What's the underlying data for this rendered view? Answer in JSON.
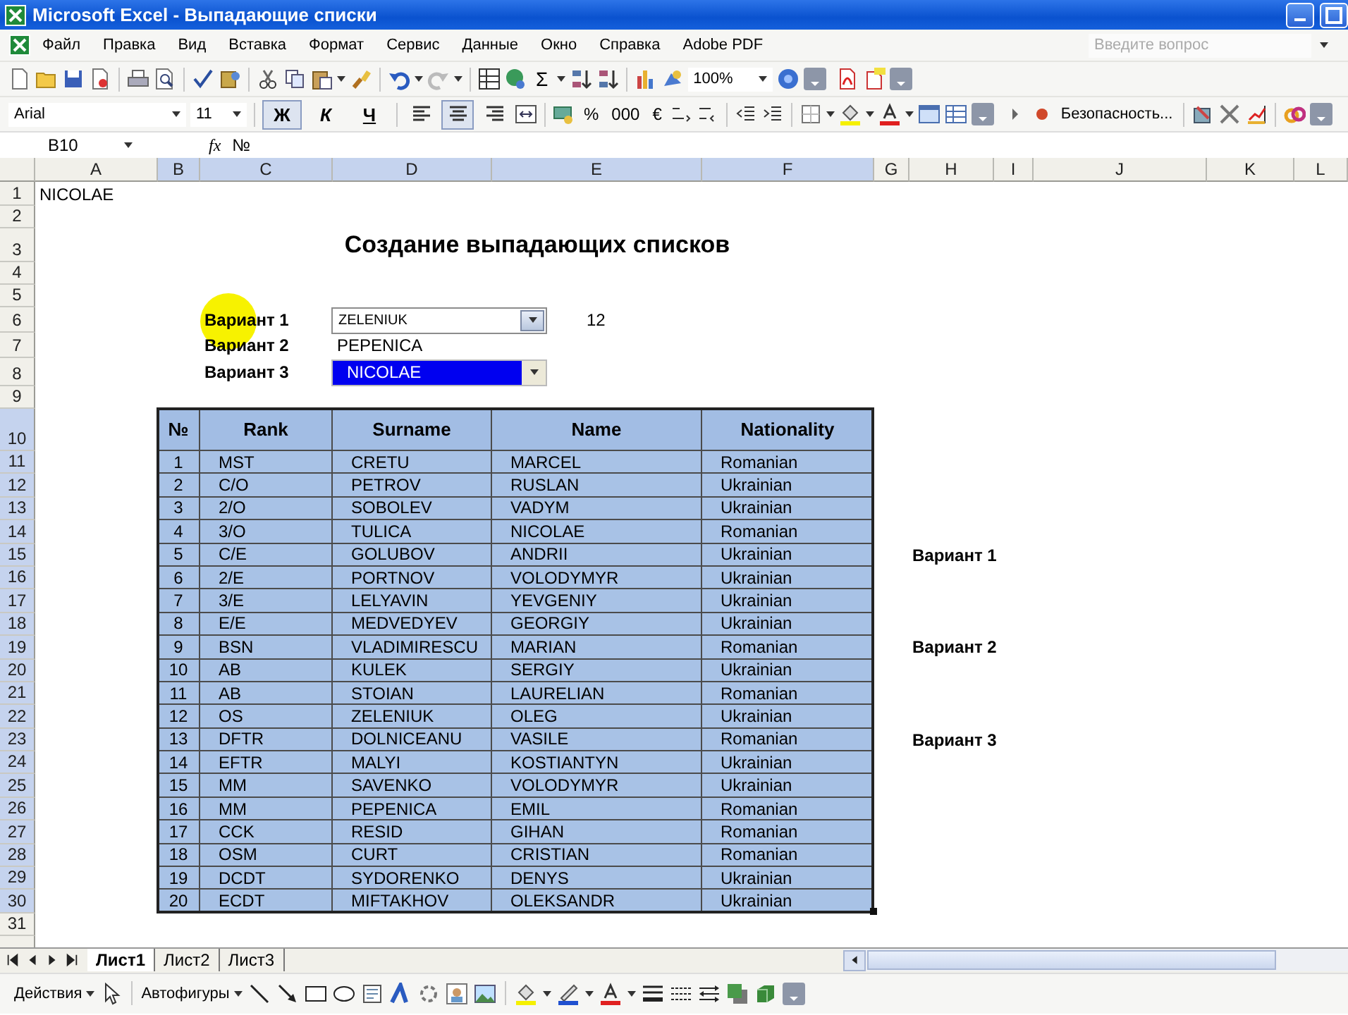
{
  "window": {
    "title": "Microsoft Excel - Выпадающие списки"
  },
  "menu": [
    "Файл",
    "Правка",
    "Вид",
    "Вставка",
    "Формат",
    "Сервис",
    "Данные",
    "Окно",
    "Справка",
    "Adobe PDF"
  ],
  "help_search": {
    "placeholder": "Введите вопрос"
  },
  "toolbar": {
    "sum": "Σ",
    "zoom": "100%",
    "font": "Arial",
    "font_size": "11",
    "security": "Безопасность...",
    "style_buttons": [
      {
        "label": "Ж",
        "pressed": true
      },
      {
        "label": "К",
        "pressed": false
      },
      {
        "label": "Ч",
        "pressed": false
      }
    ],
    "alignment": [
      {
        "selected": false
      },
      {
        "selected": true
      },
      {
        "selected": false
      }
    ],
    "number_formats": [
      "%",
      "000",
      "€"
    ]
  },
  "formula_bar": {
    "cell": "B10",
    "fx": "fx",
    "formula": "№"
  },
  "columns": [
    {
      "label": "A",
      "selected": false
    },
    {
      "label": "B",
      "selected": true
    },
    {
      "label": "C",
      "selected": true
    },
    {
      "label": "D",
      "selected": true
    },
    {
      "label": "E",
      "selected": true
    },
    {
      "label": "F",
      "selected": true
    },
    {
      "label": "G",
      "selected": false
    },
    {
      "label": "H",
      "selected": false
    },
    {
      "label": "I",
      "selected": false
    },
    {
      "label": "J",
      "selected": false
    },
    {
      "label": "K",
      "selected": false
    },
    {
      "label": "L",
      "selected": false
    }
  ],
  "rows": [
    {
      "label": "1",
      "selected": false
    },
    {
      "label": "2",
      "selected": false
    },
    {
      "label": "3",
      "selected": false
    },
    {
      "label": "4",
      "selected": false
    },
    {
      "label": "5",
      "selected": false
    },
    {
      "label": "6",
      "selected": false
    },
    {
      "label": "7",
      "selected": false
    },
    {
      "label": "8",
      "selected": false
    },
    {
      "label": "9",
      "selected": false
    },
    {
      "label": "10",
      "selected": true
    },
    {
      "label": "11",
      "selected": true
    },
    {
      "label": "12",
      "selected": true
    },
    {
      "label": "13",
      "selected": true
    },
    {
      "label": "14",
      "selected": true
    },
    {
      "label": "15",
      "selected": true
    },
    {
      "label": "16",
      "selected": true
    },
    {
      "label": "17",
      "selected": true
    },
    {
      "label": "18",
      "selected": true
    },
    {
      "label": "19",
      "selected": true
    },
    {
      "label": "20",
      "selected": true
    },
    {
      "label": "21",
      "selected": true
    },
    {
      "label": "22",
      "selected": true
    },
    {
      "label": "23",
      "selected": true
    },
    {
      "label": "24",
      "selected": true
    },
    {
      "label": "25",
      "selected": true
    },
    {
      "label": "26",
      "selected": true
    },
    {
      "label": "27",
      "selected": true
    },
    {
      "label": "28",
      "selected": true
    },
    {
      "label": "29",
      "selected": true
    },
    {
      "label": "30",
      "selected": true
    },
    {
      "label": "31",
      "selected": false
    }
  ],
  "sheet": {
    "a1": "NICOLAE",
    "heading": "Создание выпадающих списков",
    "variants": [
      {
        "label": "Вариант 1",
        "kind": "combo",
        "value": "ZELENIUK",
        "selected": false,
        "index": "12"
      },
      {
        "label": "Вариант 2",
        "kind": "text",
        "value": "PEPENICA"
      },
      {
        "label": "Вариант 3",
        "kind": "combo",
        "value": "NICOLAE",
        "selected": true
      }
    ],
    "side_labels": [
      "Вариант 1",
      "Вариант 2",
      "Вариант 3"
    ]
  },
  "table": {
    "columns": [
      "№",
      "Rank",
      "Surname",
      "Name",
      "Nationality"
    ],
    "rows": [
      [
        "1",
        "MST",
        "CRETU",
        "MARCEL",
        "Romanian"
      ],
      [
        "2",
        "C/O",
        "PETROV",
        "RUSLAN",
        "Ukrainian"
      ],
      [
        "3",
        "2/O",
        "SOBOLEV",
        "VADYM",
        "Ukrainian"
      ],
      [
        "4",
        "3/O",
        "TULICA",
        "NICOLAE",
        "Romanian"
      ],
      [
        "5",
        "C/E",
        "GOLUBOV",
        "ANDRII",
        "Ukrainian"
      ],
      [
        "6",
        "2/E",
        "PORTNOV",
        "VOLODYMYR",
        "Ukrainian"
      ],
      [
        "7",
        "3/E",
        "LELYAVIN",
        "YEVGENIY",
        "Ukrainian"
      ],
      [
        "8",
        "E/E",
        "MEDVEDYEV",
        "GEORGIY",
        "Ukrainian"
      ],
      [
        "9",
        "BSN",
        "VLADIMIRESCU",
        "MARIAN",
        "Romanian"
      ],
      [
        "10",
        "AB",
        "KULEK",
        "SERGIY",
        "Ukrainian"
      ],
      [
        "11",
        "AB",
        "STOIAN",
        "LAURELIAN",
        "Romanian"
      ],
      [
        "12",
        "OS",
        "ZELENIUK",
        "OLEG",
        "Ukrainian"
      ],
      [
        "13",
        "DFTR",
        "DOLNICEANU",
        "VASILE",
        "Romanian"
      ],
      [
        "14",
        "EFTR",
        "MALYI",
        "KOSTIANTYN",
        "Ukrainian"
      ],
      [
        "15",
        "MM",
        "SAVENKO",
        "VOLODYMYR",
        "Ukrainian"
      ],
      [
        "16",
        "MM",
        "PEPENICA",
        "EMIL",
        "Romanian"
      ],
      [
        "17",
        "CCK",
        "RESID",
        "GIHAN",
        "Romanian"
      ],
      [
        "18",
        "OSM",
        "CURT",
        "CRISTIAN",
        "Romanian"
      ],
      [
        "19",
        "DCDT",
        "SYDORENKO",
        "DENYS",
        "Ukrainian"
      ],
      [
        "20",
        "ECDT",
        "MIFTAKHOV",
        "OLEKSANDR",
        "Ukrainian"
      ]
    ]
  },
  "sheet_tabs": [
    {
      "label": "Лист1",
      "selected": true
    },
    {
      "label": "Лист2",
      "selected": false
    },
    {
      "label": "Лист3",
      "selected": false
    }
  ],
  "drawing_toolbar": {
    "actions": "Действия",
    "autoshapes": "Автофигуры"
  }
}
